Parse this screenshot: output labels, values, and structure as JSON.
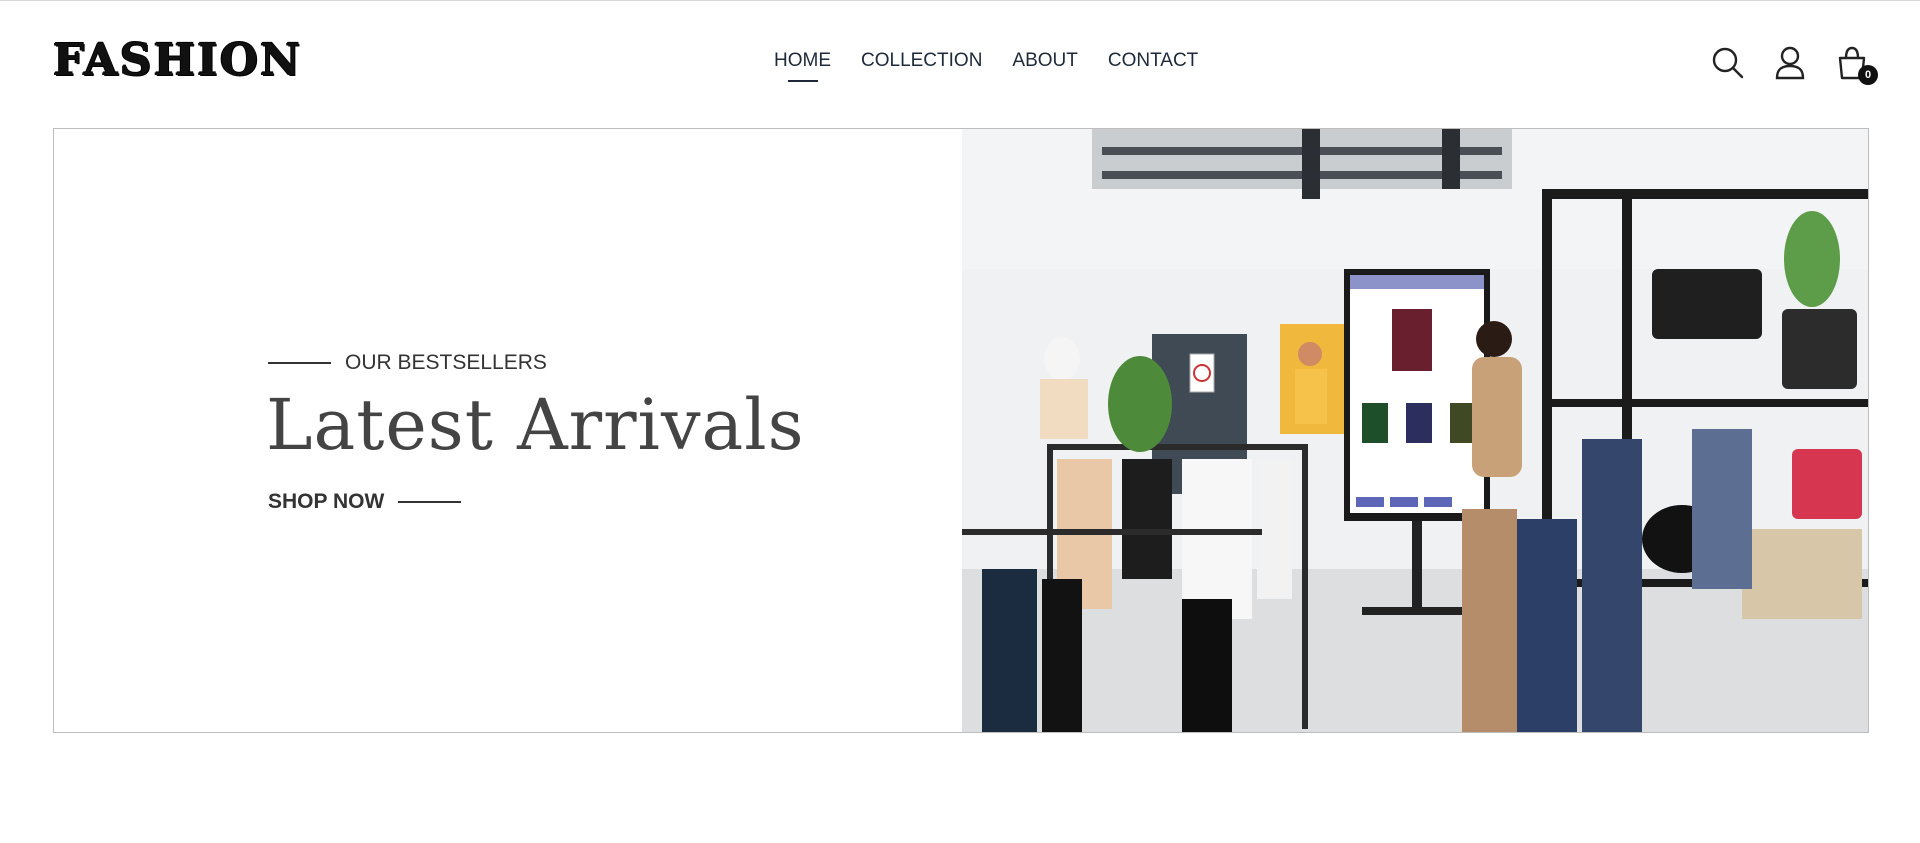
{
  "brand": {
    "logo_text": "FASHION"
  },
  "nav": {
    "items": [
      {
        "label": "HOME",
        "active": true
      },
      {
        "label": "COLLECTION",
        "active": false
      },
      {
        "label": "ABOUT",
        "active": false
      },
      {
        "label": "CONTACT",
        "active": false
      }
    ]
  },
  "header_icons": {
    "search": "search-icon",
    "account": "user-icon",
    "cart": "shopping-bag-icon",
    "cart_count": "0"
  },
  "hero": {
    "eyebrow": "OUR BESTSELLERS",
    "title": "Latest Arrivals",
    "cta": "SHOP NOW",
    "image_subject": "clothing store interior with racks, mannequins and a touchscreen kiosk"
  },
  "colors": {
    "text_dark": "#1e2a3a",
    "text_body": "#333333",
    "border": "#bdbdbd"
  }
}
